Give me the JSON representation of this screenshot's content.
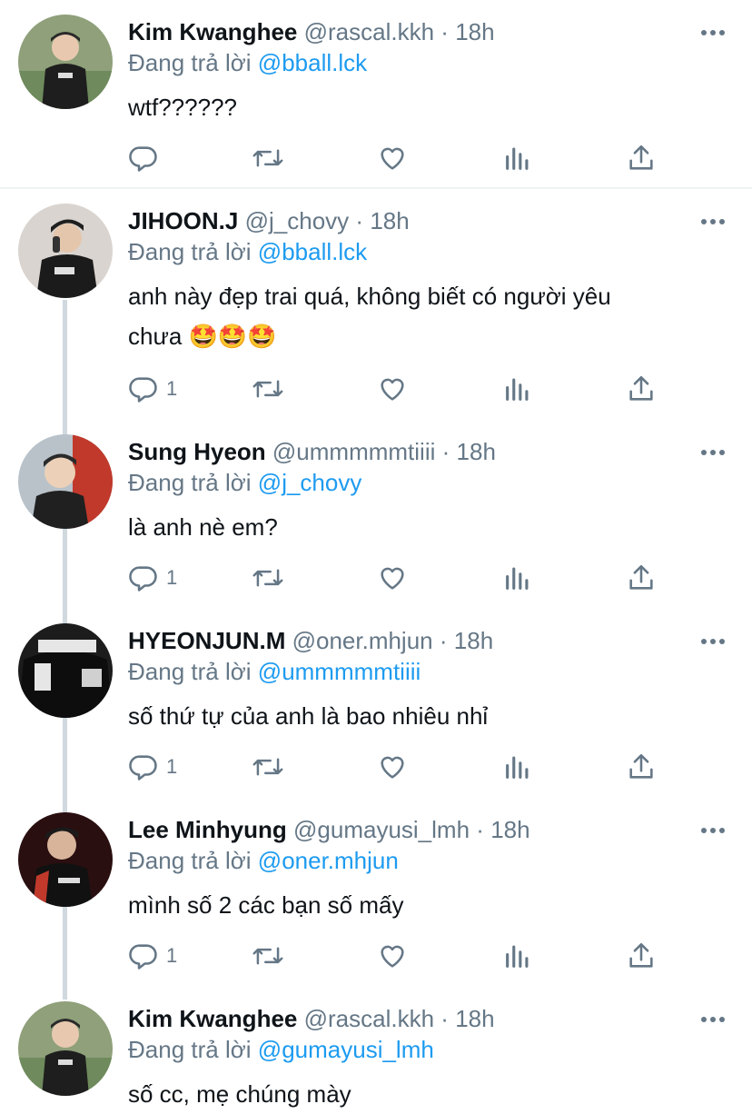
{
  "tweets": [
    {
      "name": "Kim Kwanghee",
      "handle": "@rascal.kkh",
      "dot": "·",
      "time": "18h",
      "reply_prefix": "Đang trả lời",
      "reply_to": "@bball.lck",
      "text_line1": "wtf??????",
      "text_line2": "",
      "reply_count": "",
      "avatar": "photo-man-gray-sweater"
    },
    {
      "name": "JIHOON.J",
      "handle": "@j_chovy",
      "dot": "·",
      "time": "18h",
      "reply_prefix": "Đang trả lời",
      "reply_to": "@bball.lck",
      "text_line1": "anh này đẹp trai quá, không biết có người yêu",
      "text_line2": "chưa 🤩🤩🤩",
      "reply_count": "1",
      "avatar": "photo-man-phone"
    },
    {
      "name": "Sung Hyeon",
      "handle": "@ummmmmtiiii",
      "dot": "·",
      "time": "18h",
      "reply_prefix": "Đang trả lời",
      "reply_to": "@j_chovy",
      "text_line1": "là anh nè em?",
      "text_line2": "",
      "reply_count": "1",
      "avatar": "photo-man-selfie"
    },
    {
      "name": "HYEONJUN.M",
      "handle": "@oner.mhjun",
      "dot": "·",
      "time": "18h",
      "reply_prefix": "Đang trả lời",
      "reply_to": "@ummmmmtiiii",
      "text_line1": "số thứ tự của anh là bao nhiêu nhỉ",
      "text_line2": "",
      "reply_count": "1",
      "avatar": "photo-champion-jacket"
    },
    {
      "name": "Lee Minhyung",
      "handle": "@gumayusi_lmh",
      "dot": "·",
      "time": "18h",
      "reply_prefix": "Đang trả lời",
      "reply_to": "@oner.mhjun",
      "text_line1": "mình số 2 các bạn số mấy",
      "text_line2": "",
      "reply_count": "1",
      "avatar": "photo-man-jersey-red"
    },
    {
      "name": "Kim Kwanghee",
      "handle": "@rascal.kkh",
      "dot": "·",
      "time": "18h",
      "reply_prefix": "Đang trả lời",
      "reply_to": "@gumayusi_lmh",
      "text_line1": "số cc, mẹ chúng mày",
      "text_line2": "",
      "reply_count": "",
      "avatar": "photo-man-gray-sweater"
    }
  ],
  "icons": {
    "reply": "reply-icon",
    "retweet": "retweet-icon",
    "like": "heart-icon",
    "analytics": "analytics-icon",
    "share": "share-icon",
    "more": "more-icon"
  },
  "colors": {
    "mention": "#1d9bf0",
    "secondary": "#657786",
    "text": "#0f1419",
    "thread_line": "#cfd9de"
  }
}
